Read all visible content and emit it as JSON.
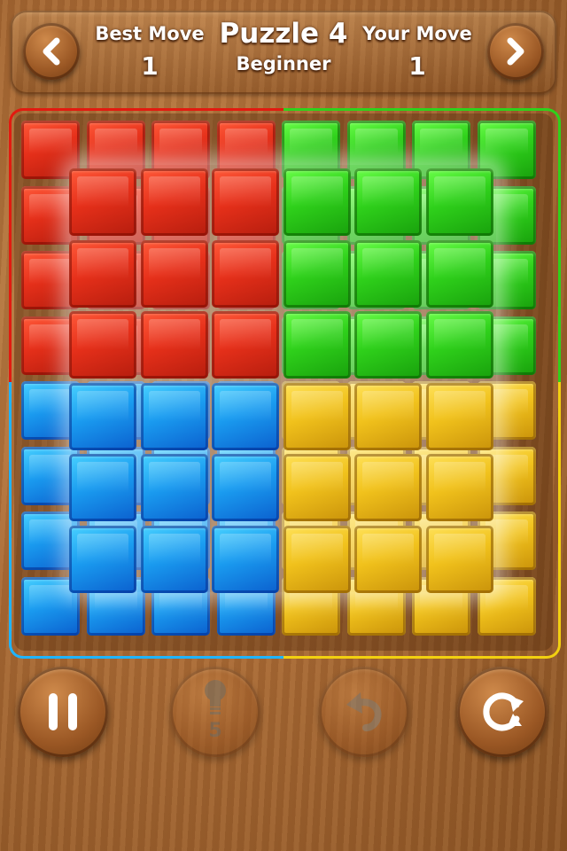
{
  "header": {
    "best_move_label": "Best Move",
    "best_move_value": "1",
    "puzzle_title": "Puzzle 4",
    "difficulty": "Beginner",
    "your_move_label": "Your Move",
    "your_move_value": "1"
  },
  "nav": {
    "prev_icon": "chevron-left-icon",
    "next_icon": "chevron-right-icon"
  },
  "controls": {
    "pause_icon": "pause-icon",
    "hint_icon": "lightbulb-icon",
    "hint_count": "5",
    "hint_enabled": false,
    "undo_icon": "undo-icon",
    "restart_icon": "restart-icon"
  },
  "board": {
    "rows": 8,
    "cols": 8,
    "colors": {
      "red": "#e6301a",
      "green": "#2fd11b",
      "blue": "#1a9cf0",
      "yellow": "#f1c21c"
    },
    "back_grid": [
      [
        "red",
        "red",
        "red",
        "red",
        "green",
        "green",
        "green",
        "green"
      ],
      [
        "red",
        "red",
        "red",
        "red",
        "green",
        "green",
        "green",
        "green"
      ],
      [
        "red",
        "red",
        "red",
        "red",
        "green",
        "green",
        "green",
        "green"
      ],
      [
        "red",
        "red",
        "red",
        "red",
        "green",
        "green",
        "green",
        "green"
      ],
      [
        "blue",
        "blue",
        "blue",
        "blue",
        "yellow",
        "yellow",
        "yellow",
        "yellow"
      ],
      [
        "blue",
        "blue",
        "blue",
        "blue",
        "yellow",
        "yellow",
        "yellow",
        "yellow"
      ],
      [
        "blue",
        "blue",
        "blue",
        "blue",
        "yellow",
        "yellow",
        "yellow",
        "yellow"
      ],
      [
        "blue",
        "blue",
        "blue",
        "blue",
        "yellow",
        "yellow",
        "yellow",
        "yellow"
      ]
    ],
    "front_grid": [
      [
        "red",
        "red",
        "red",
        "green",
        "green",
        "green"
      ],
      [
        "red",
        "red",
        "red",
        "green",
        "green",
        "green"
      ],
      [
        "red",
        "red",
        "red",
        "green",
        "green",
        "green"
      ],
      [
        "blue",
        "blue",
        "blue",
        "yellow",
        "yellow",
        "yellow"
      ],
      [
        "blue",
        "blue",
        "blue",
        "yellow",
        "yellow",
        "yellow"
      ],
      [
        "blue",
        "blue",
        "blue",
        "yellow",
        "yellow",
        "yellow"
      ]
    ]
  }
}
